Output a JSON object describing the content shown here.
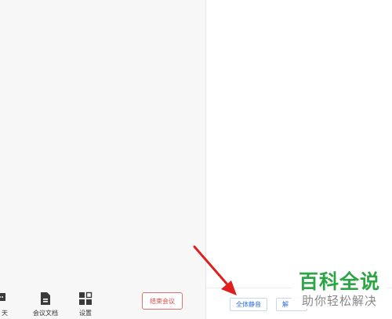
{
  "toolbar": {
    "chat_label": "天",
    "docs_label": "会议文档",
    "settings_label": "设置",
    "end_meeting_label": "结束会议"
  },
  "participants_panel": {
    "mute_all_label": "全体静音",
    "unmute_all_label": "解"
  },
  "watermark": {
    "title": "百科全说",
    "subtitle": "助你轻松解决"
  },
  "colors": {
    "accent_blue": "#2f6fd8",
    "end_red": "#d94848",
    "annotation_red": "#e01e1e",
    "watermark_green": "#2ca544"
  },
  "icons": {
    "chat": "chat-bubble-icon",
    "docs": "document-icon",
    "settings": "grid-settings-icon",
    "annotation": "red-arrow-icon"
  }
}
